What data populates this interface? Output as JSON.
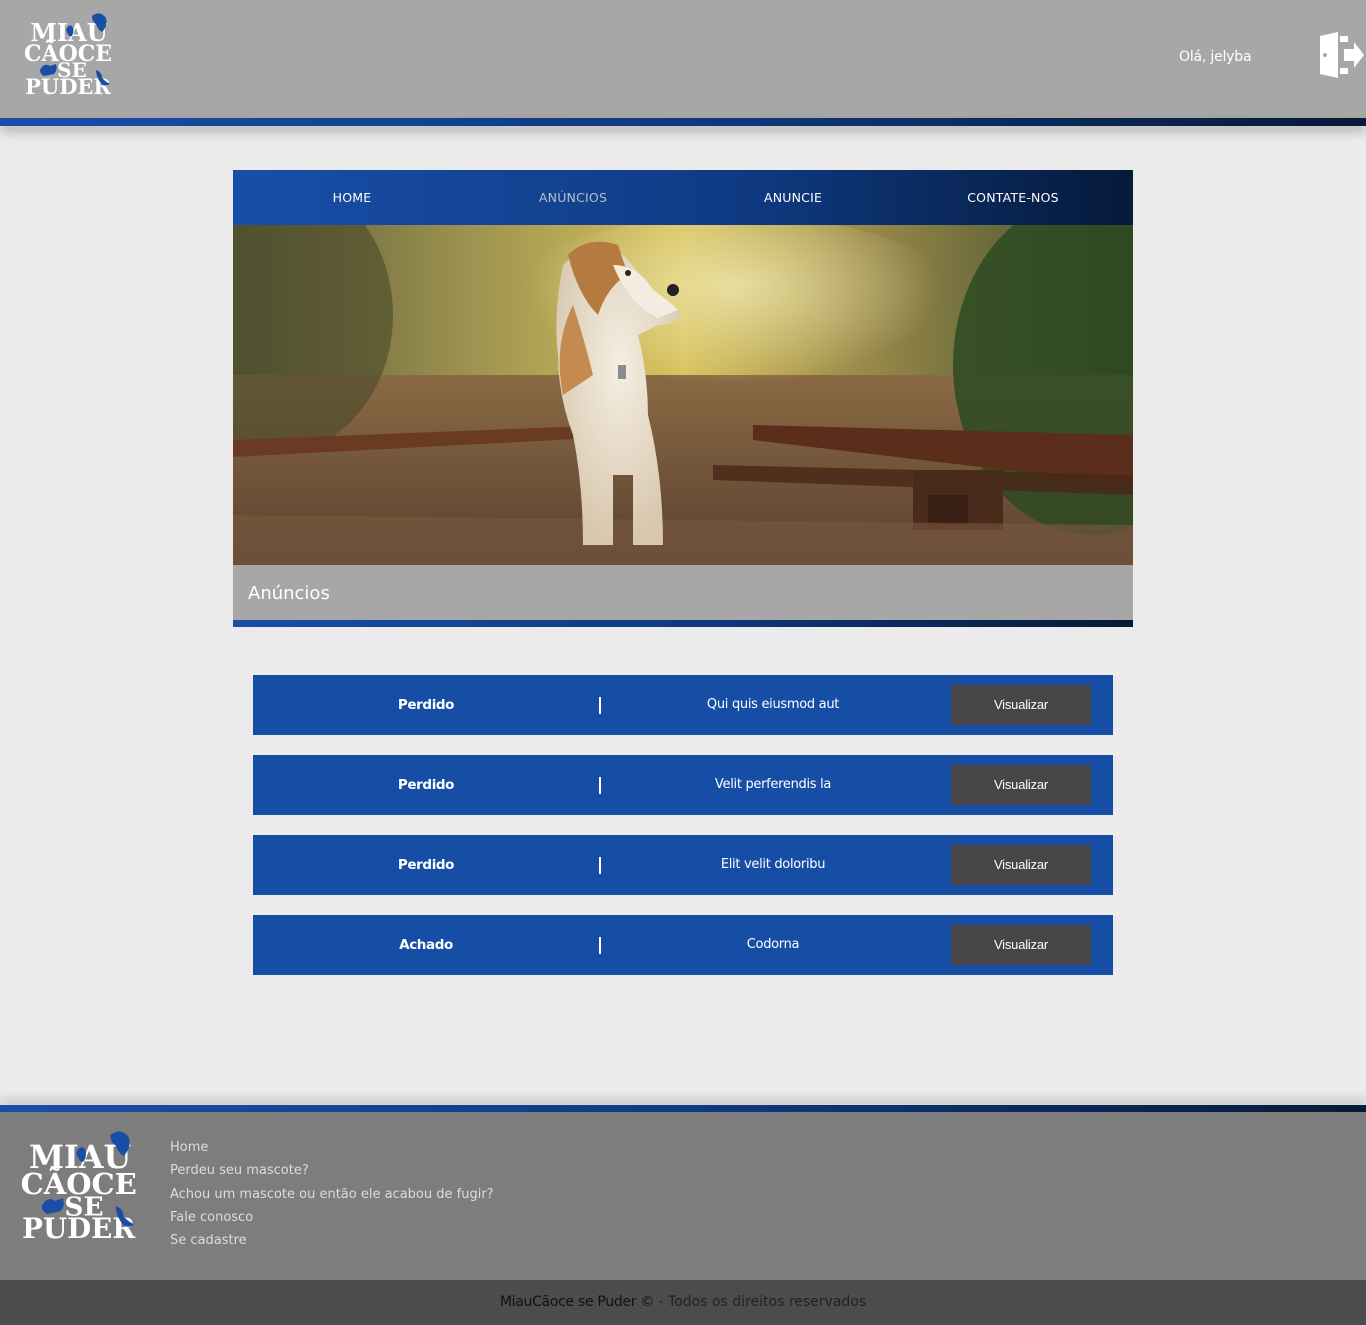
{
  "header": {
    "greeting": "Olá, jelyba",
    "logout_icon": "logout-door-icon",
    "logo_lines": [
      "MIAU",
      "CÃOCE",
      "SE",
      "PUDER"
    ]
  },
  "nav": {
    "items": [
      {
        "label": "HOME",
        "active": false
      },
      {
        "label": "ANÚNCIOS",
        "active": true
      },
      {
        "label": "ANUNCIE",
        "active": false
      },
      {
        "label": "CONTATE-NOS",
        "active": false
      }
    ]
  },
  "hero": {
    "image": "dog-on-railway-photo"
  },
  "section": {
    "title": "Anúncios"
  },
  "listings": [
    {
      "status": "Perdido",
      "title": "Qui quis eiusmod aut",
      "button": "Visualizar"
    },
    {
      "status": "Perdido",
      "title": "Velit perferendis la",
      "button": "Visualizar"
    },
    {
      "status": "Perdido",
      "title": "Elit velit doloribu",
      "button": "Visualizar"
    },
    {
      "status": "Achado",
      "title": "Codorna",
      "button": "Visualizar"
    }
  ],
  "footer": {
    "links": [
      "Home",
      "Perdeu seu mascote?",
      "Achou um mascote ou então ele acabou de fugir?",
      "Fale conosco",
      "Se cadastre"
    ],
    "copyright_brand": "MiauCãoce se Puder ©",
    "copyright_rest": " - Todos os direitos reservados"
  },
  "colors": {
    "primary_blue": "#164ea5",
    "dark_blue": "#061a3a",
    "header_gray": "#a7a7a7",
    "button_gray": "#464646",
    "footer_gray": "#7d7d7d"
  }
}
